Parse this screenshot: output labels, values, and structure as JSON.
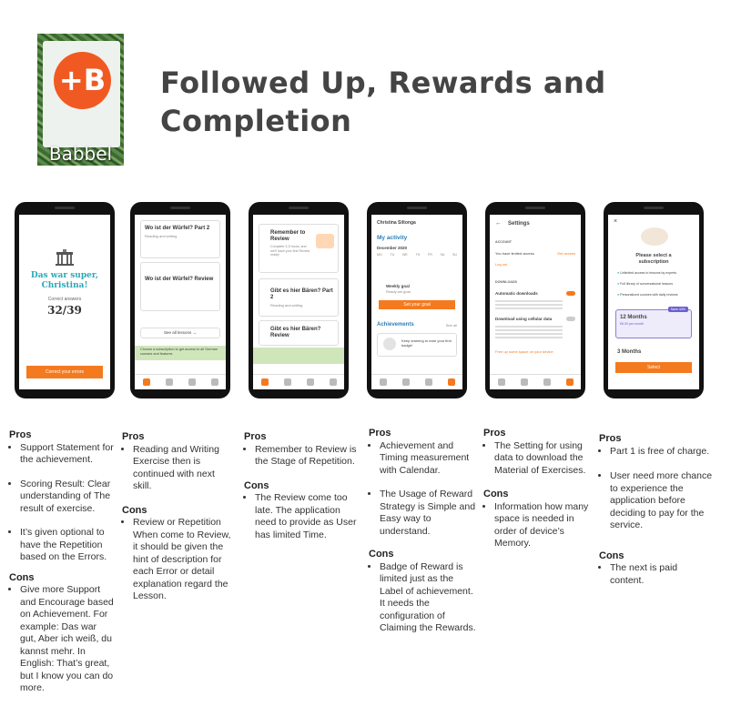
{
  "logo": {
    "glyph": "+B",
    "wordmark": "Babbel"
  },
  "title": "Followed Up, Rewards and Completion",
  "colors": {
    "brand_orange": "#f47a1f",
    "title_gray": "#444444",
    "band_green": "#cfe6bb"
  },
  "columns": [
    {
      "pros_heading": "Pros",
      "pros": [
        "Support Statement for the achievement.",
        "Scoring Result: Clear understanding of The result of exercise.",
        "It’s given optional to have the Repetition based on the Errors."
      ],
      "cons_heading": "Cons",
      "cons": [
        "Give more Support and Encourage based on Achievement. For example: Das war gut, Aber ich weiß, du kannst mehr. In English: That’s great, but I know you can do more."
      ]
    },
    {
      "pros_heading": "Pros",
      "pros": [
        "Reading and Writing Exercise then is continued with next skill."
      ],
      "cons_heading": "Cons",
      "cons": [
        "Review or Repetition When come to Review, it should be given the hint of description for each Error or detail explanation regard the Lesson."
      ]
    },
    {
      "pros_heading": "Pros",
      "pros": [
        "Remember to Review is the Stage of Repetition."
      ],
      "cons_heading": "Cons",
      "cons": [
        "The Review come too late. The application need to provide as User has limited Time."
      ]
    },
    {
      "pros_heading": "Pros",
      "pros": [
        "Achievement and Timing measurement  with Calendar.",
        "The Usage of Reward Strategy is Simple and Easy way to understand."
      ],
      "cons_heading": "Cons",
      "cons": [
        "Badge of Reward is limited just as the Label of achievement. It needs the configuration of Claiming the Rewards."
      ]
    },
    {
      "pros_heading": "Pros",
      "pros": [
        "The Setting for using data to download the Material of Exercises."
      ],
      "cons_heading": "Cons",
      "cons": [
        "Information how many space is needed in order of device’s Memory."
      ]
    },
    {
      "pros_heading": "Pros",
      "pros": [
        "Part 1 is free of charge.",
        "User need more chance to experience the application before deciding to pay for the service."
      ],
      "cons_heading": "Cons",
      "cons": [
        "The next is paid content."
      ]
    }
  ],
  "phones": {
    "p1": {
      "headline": "Das war super, Christina!",
      "answers_label": "Correct answers",
      "score": "32/39",
      "button": "Correct your errors"
    },
    "p2": {
      "lesson1": "Wo ist der Würfel? Part 2",
      "lesson1_sub": "Reading and writing",
      "lesson2": "Wo ist der Würfel? Review",
      "see_all": "See all lessons →",
      "band": "Choose a subscription to get access to all German courses and features"
    },
    "p3": {
      "card1": "Remember to Review",
      "card1_sub": "Complete 3-5 hours, and we'll have your first Review ready!",
      "card2": "Gibt es hier Bären? Part 2",
      "card2_sub": "Reading and writing",
      "card3": "Gibt es hier Bären? Review"
    },
    "p4": {
      "user": "Christina Siltonga",
      "section": "My activity",
      "month": "December 2020",
      "days": [
        "MO",
        "TU",
        "WE",
        "TH",
        "FR",
        "SA",
        "SU"
      ],
      "goal": "Weekly goal",
      "goal_sub": "Ready set goal",
      "goal_button": "Set your goal",
      "achievements": "Achievements",
      "see_all": "See all",
      "badge_text": "Keep learning to earn your first badge!"
    },
    "p5": {
      "header": "Settings",
      "account": "ACCOUNT",
      "limited": "You have limited access",
      "get_access": "Get access",
      "logout": "Log out",
      "downloads": "DOWNLOADS",
      "auto": "Automatic downloads",
      "cellular": "Download using cellular data",
      "free_space": "Free up some space on your device"
    },
    "p6": {
      "heading": "Please select a subscription",
      "benefits": [
        "Unlimited access to lessons by experts",
        "Full library of conversational lessons",
        "Personalized courses with daily reviews"
      ],
      "badge": "Save 44%",
      "plan1": "12 Months",
      "plan1_price": "€6.00 per month",
      "plan2": "3 Months",
      "button": "Select"
    }
  }
}
